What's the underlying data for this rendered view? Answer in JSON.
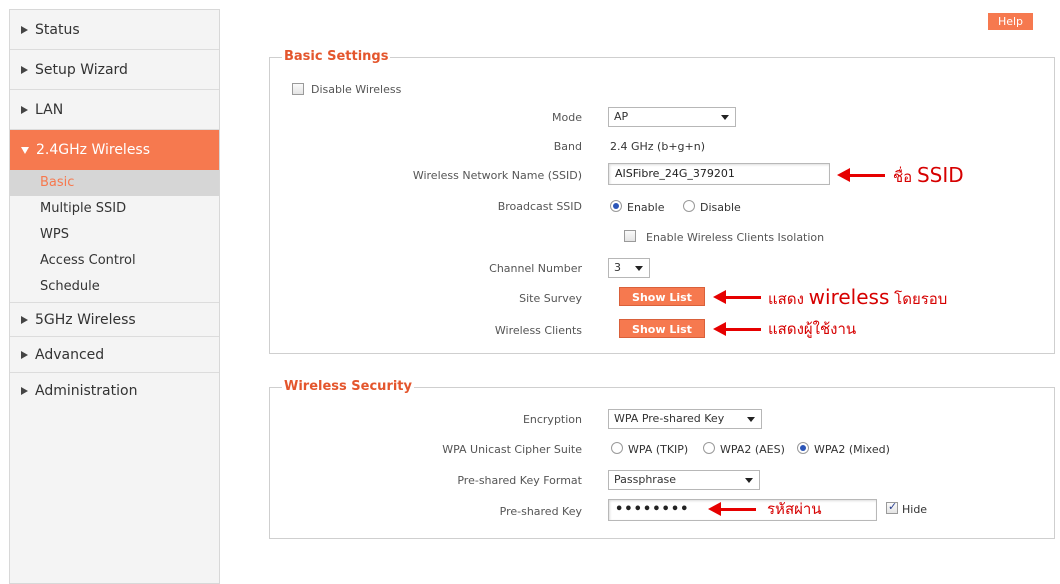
{
  "sidebar": {
    "items": [
      {
        "label": "Status"
      },
      {
        "label": "Setup Wizard"
      },
      {
        "label": "LAN"
      },
      {
        "label": "2.4GHz Wireless"
      },
      {
        "label": "5GHz Wireless"
      },
      {
        "label": "Advanced"
      },
      {
        "label": "Administration"
      }
    ],
    "subitems": [
      "Basic",
      "Multiple SSID",
      "WPS",
      "Access Control",
      "Schedule"
    ]
  },
  "header": {
    "help_label": "Help"
  },
  "basic": {
    "legend": "Basic Settings",
    "disable_wireless": "Disable  Wireless",
    "mode_label": "Mode",
    "mode_value": "AP",
    "band_label": "Band",
    "band_value": "2.4 GHz (b+g+n)",
    "ssid_label": "Wireless Network Name  (SSID)",
    "ssid_value": "AISFibre_24G_379201",
    "broadcast_label": "Broadcast SSID",
    "broadcast_enable": "Enable",
    "broadcast_disable": "Disable",
    "isolation_label": "Enable Wireless Clients Isolation",
    "channel_label": "Channel Number",
    "channel_value": "3",
    "site_survey_label": "Site Survey",
    "wireless_clients_label": "Wireless Clients",
    "show_list": "Show List"
  },
  "security": {
    "legend": "Wireless  Security",
    "encryption_label": "Encryption",
    "encryption_value": "WPA Pre-shared Key",
    "cipher_label": "WPA Unicast Cipher Suite",
    "cipher_tkip": "WPA (TKIP)",
    "cipher_aes": "WPA2 (AES)",
    "cipher_mixed": "WPA2 (Mixed)",
    "format_label": "Pre-shared Key Format",
    "format_value": "Passphrase",
    "key_label": "Pre-shared Key",
    "key_value": "••••••••",
    "hide_label": "Hide"
  },
  "annotations": {
    "ssid_note_th": "ชื่อ",
    "ssid_note_en": "SSID",
    "survey_note_a": "แสดง",
    "survey_note_b": "wireless",
    "survey_note_c": "โดยรอบ",
    "clients_note": "แสดงผู้ใช้งาน",
    "key_note": "รหัสผ่าน"
  },
  "colors": {
    "accent": "#f6794f",
    "legend": "#e4562d",
    "annotation": "#e60000"
  }
}
